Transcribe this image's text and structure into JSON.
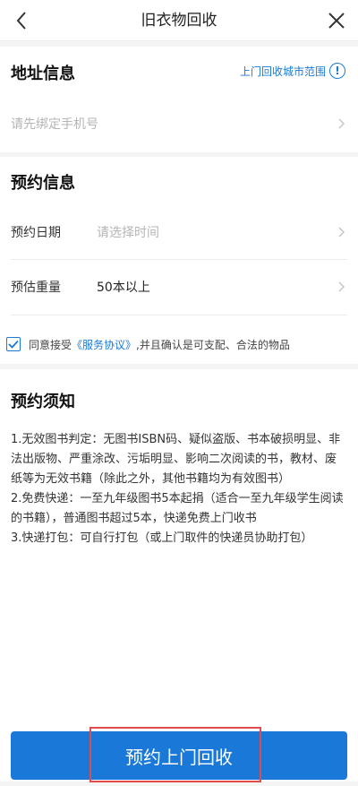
{
  "header": {
    "title": "旧衣物回收",
    "back_icon": "chevron-left-icon",
    "close_icon": "close-icon"
  },
  "address": {
    "section_title": "地址信息",
    "range_link": "上门回收城市范围",
    "range_icon": "info-icon",
    "phone_placeholder": "请先绑定手机号"
  },
  "booking": {
    "section_title": "预约信息",
    "date_label": "预约日期",
    "date_placeholder": "请选择时间",
    "weight_label": "预估重量",
    "weight_value": "50本以上"
  },
  "agreement": {
    "checked": true,
    "prefix": "同意接受",
    "link_text": "《服务协议》",
    "suffix": ",并且确认是可支配、合法的物品"
  },
  "notice": {
    "section_title": "预约须知",
    "items": [
      "1.无效图书判定：无图书ISBN码、疑似盗版、书本破损明显、非法出版物、严重涂改、污垢明显、影响二次阅读的书，教材、废纸等为无效书籍（除此之外，其他书籍均为有效图书）",
      "2.免费快递：一至九年级图书5本起捐（适合一至九年级学生阅读的书籍），普通图书超过5本，快递免费上门收书",
      "3.快递打包：可自行打包（或上门取件的快递员协助打包）"
    ]
  },
  "bottom_button": {
    "label": "预约上门回收"
  },
  "colors": {
    "accent": "#1a79d8",
    "highlight": "#e04b4b"
  }
}
